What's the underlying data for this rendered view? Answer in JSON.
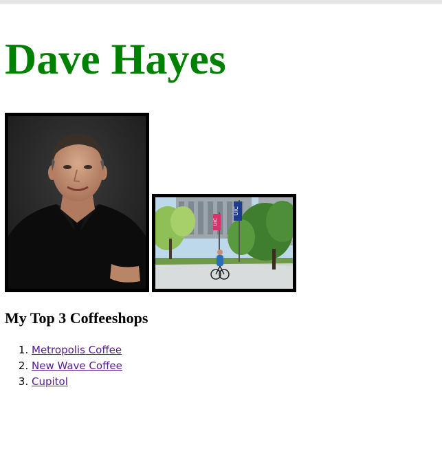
{
  "page": {
    "title": "Dave Hayes"
  },
  "images": {
    "portrait_alt": "Portrait photo",
    "campus_alt": "UIC campus photo",
    "banner_left": "UIC",
    "banner_right": "UIC"
  },
  "coffee": {
    "heading": "My Top 3 Coffeeshops",
    "items": [
      {
        "label": "Metropolis Coffee"
      },
      {
        "label": "New Wave Coffee"
      },
      {
        "label": "Cupitol"
      }
    ]
  },
  "colors": {
    "title": "#008000",
    "link_visited": "#551a8b"
  }
}
